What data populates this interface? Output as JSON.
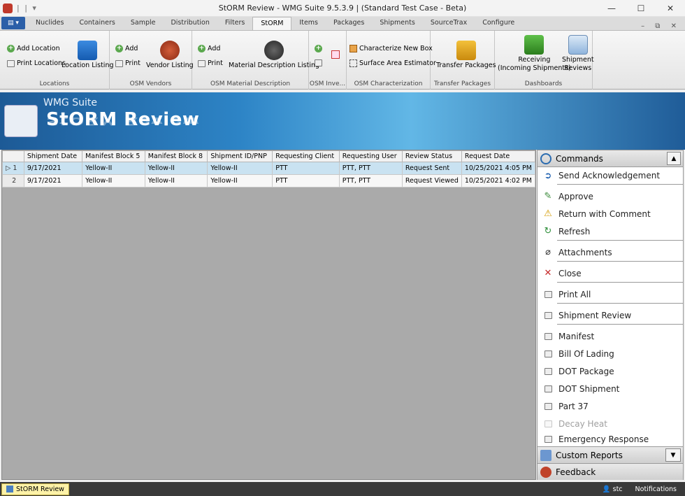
{
  "window": {
    "title": "StORM Review - WMG Suite  9.5.3.9  |  (Standard Test Case - Beta)",
    "qat": "| | ▾",
    "buttons": [
      "—",
      "☐",
      "✕"
    ]
  },
  "tabs": [
    "Nuclides",
    "Containers",
    "Sample",
    "Distribution",
    "Filters",
    "StORM",
    "Items",
    "Packages",
    "Shipments",
    "SourceTrax",
    "Configure"
  ],
  "mdi_buttons": "– ⧉ ✕",
  "ribbon": {
    "locations": {
      "label": "Locations",
      "add": "Add Location",
      "print": "Print Locations",
      "listing": "Location Listing"
    },
    "vendors": {
      "label": "OSM Vendors",
      "add": "Add",
      "print": "Print",
      "listing": "Vendor Listing"
    },
    "material": {
      "label": "OSM Material Description",
      "add": "Add",
      "print": "Print",
      "listing": "Material Description Listing"
    },
    "inventory": {
      "label": "OSM Inve..."
    },
    "characterization": {
      "label": "OSM Characterization",
      "box": "Characterize New Box",
      "surface": "Surface Area Estimator"
    },
    "transfer": {
      "label": "Transfer Packages",
      "btn": "Transfer Packages"
    },
    "dashboards": {
      "label": "Dashboards",
      "receiving1": "Receiving",
      "receiving2": "(Incoming Shipments)",
      "reviews1": "Shipment",
      "reviews2": "Reviews"
    }
  },
  "banner": {
    "suite": "WMG Suite",
    "title": "StORM Review"
  },
  "grid": {
    "columns": [
      "Shipment Date",
      "Manifest Block 5",
      "Manifest Block 8",
      "Shipment ID/PNP",
      "Requesting Client",
      "Requesting User",
      "Review Status",
      "Request Date"
    ],
    "rows": [
      {
        "num": "1",
        "cells": [
          "9/17/2021",
          "Yellow-II",
          "Yellow-II",
          "Yellow-II",
          "PTT",
          "PTT, PTT",
          "Request Sent",
          "10/25/2021 4:05 PM"
        ]
      },
      {
        "num": "2",
        "cells": [
          "9/17/2021",
          "Yellow-II",
          "Yellow-II",
          "Yellow-II",
          "PTT",
          "PTT, PTT",
          "Request Viewed",
          "10/25/2021 4:02 PM"
        ]
      }
    ]
  },
  "commands": {
    "title": "Commands",
    "items": [
      "Send Acknowledgement",
      "Approve",
      "Return with Comment",
      "Refresh",
      "Attachments",
      "Close",
      "Print All",
      "Shipment Review",
      "Manifest",
      "Bill Of Lading",
      "DOT Package",
      "DOT Shipment",
      "Part 37",
      "Decay Heat",
      "Emergency Response"
    ]
  },
  "panels": {
    "custom_reports": "Custom Reports",
    "feedback": "Feedback"
  },
  "statusbar": {
    "tab": "StORM Review",
    "user": "stc",
    "notifications": "Notifications"
  }
}
